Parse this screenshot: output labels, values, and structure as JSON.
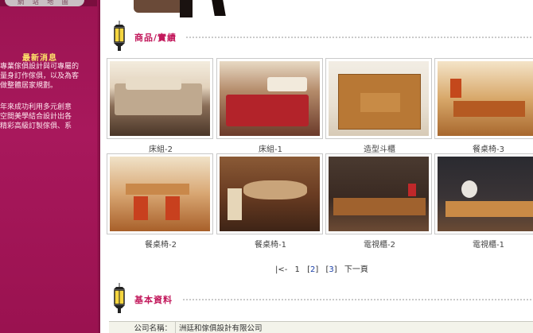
{
  "sidebar": {
    "top_tab": "網 站 地 圖",
    "news_title": "最新消息",
    "news_paragraph_1": "專業傢俱設計與可專屬的\n量身訂作傢俱，以及為客\n做整體居家規劃。",
    "news_paragraph_2": "年來成功利用多元創意\n空間美學結合設計出各\n精彩高級訂製傢俱、系"
  },
  "products_section": {
    "title": "商品/實績",
    "items": [
      {
        "caption": "床組-2"
      },
      {
        "caption": "床組-1"
      },
      {
        "caption": "造型斗櫃"
      },
      {
        "caption": "餐桌椅-3"
      },
      {
        "caption": "餐桌椅-2"
      },
      {
        "caption": "餐桌椅-1"
      },
      {
        "caption": "電視櫃-2"
      },
      {
        "caption": "電視櫃-1"
      }
    ]
  },
  "pagination": {
    "first": "|<-",
    "current": "1",
    "page2": "2",
    "page3": "3",
    "bracket_open": "[",
    "bracket_close": "]",
    "next": "下一頁"
  },
  "info_section": {
    "title": "基本資料",
    "company_label": "公司名稱：",
    "company_value": "洲廷和傢俱設計有限公司"
  },
  "colors": {
    "sidebar": "#a8185c",
    "accent_title": "#c2185b",
    "news_title": "#ffe46a",
    "link": "#1a3fa8"
  }
}
